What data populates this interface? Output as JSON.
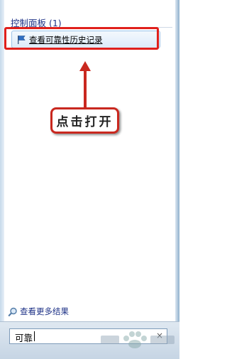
{
  "group": {
    "title": "控制面板 (1)",
    "items": [
      {
        "label": "查看可靠性历史记录",
        "icon": "flag-icon"
      }
    ]
  },
  "annotation": {
    "callout_text": "点击打开",
    "highlight_color": "#e0201c",
    "arrow_color": "#c9281f"
  },
  "footer": {
    "see_more_label": "查看更多结果",
    "see_more_icon": "search-icon"
  },
  "search": {
    "value": "可靠",
    "clear_glyph": "×"
  },
  "colors": {
    "header_text": "#1e3287",
    "selection_border": "#9cc2e8"
  }
}
